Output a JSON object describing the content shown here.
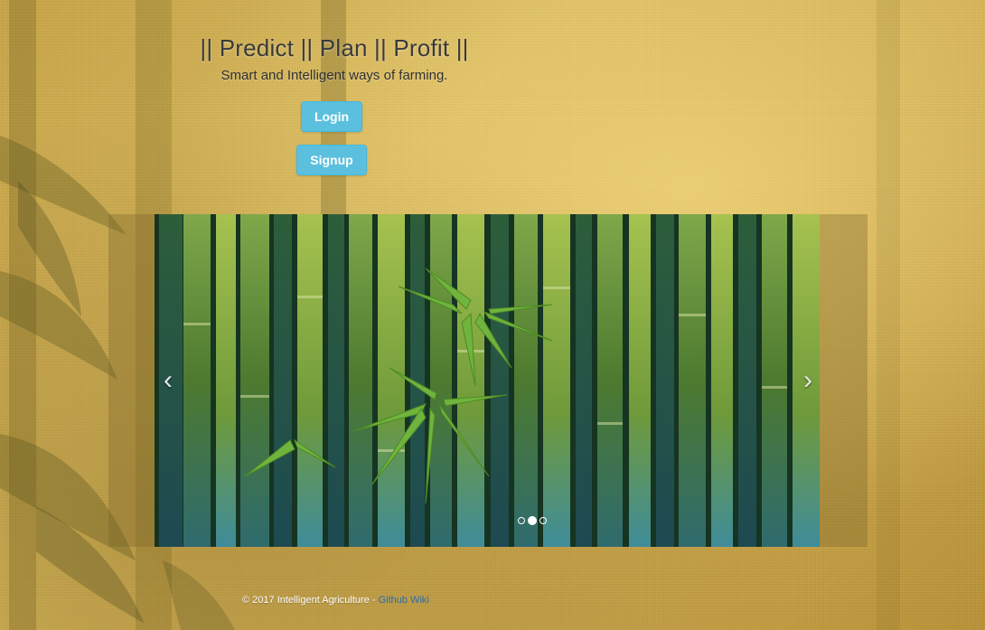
{
  "header": {
    "tagline": "|| Predict || Plan || Profit ||",
    "subtitle": "Smart and Intelligent ways of farming."
  },
  "buttons": {
    "login_label": "Login",
    "signup_label": "Signup"
  },
  "carousel": {
    "prev_glyph": "‹",
    "next_glyph": "›",
    "slide_count": 3,
    "active_slide": 2
  },
  "footer": {
    "copyright": "© 2017 Intelligent Agriculture - ",
    "link_label": "Github Wiki"
  },
  "colors": {
    "button_bg": "#5bc0de",
    "button_text": "#ffffff",
    "link": "#2a6db0"
  }
}
